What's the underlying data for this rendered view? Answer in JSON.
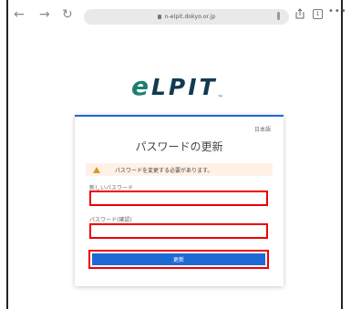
{
  "browser": {
    "url": "n-elpit.dokyo.or.jp",
    "tab_count": "1",
    "more": "•••"
  },
  "logo": {
    "text_e": "e",
    "text_rest": "LPIT",
    "tm": "™"
  },
  "card": {
    "language": "日本語",
    "title": "パスワードの更新",
    "warning": "パスワードを変更する必要があります。",
    "new_password_label": "新しいパスワード",
    "confirm_password_label": "パスワード(確認)",
    "update_button": "更新"
  }
}
